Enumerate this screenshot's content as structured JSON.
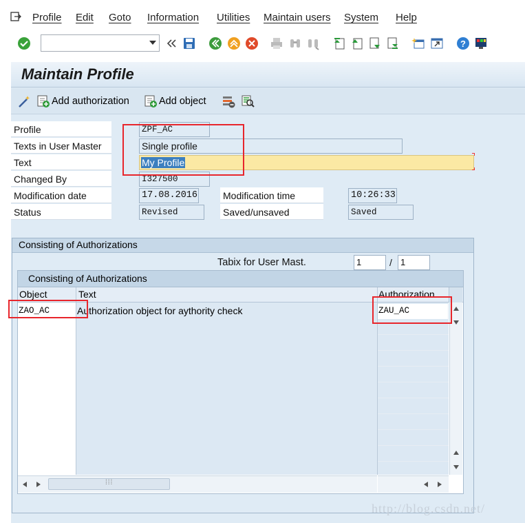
{
  "menu": [
    "Profile",
    "Edit",
    "Goto",
    "Information",
    "Utilities",
    "Maintain users",
    "System",
    "Help"
  ],
  "toolbar": {
    "command_field": "",
    "icons": [
      "enter-icon",
      "back-chevrons-icon",
      "save-icon",
      "back-icon",
      "exit-icon",
      "cancel-icon",
      "print-icon",
      "find-icon",
      "find-next-icon",
      "first-page-icon",
      "prev-page-icon",
      "next-page-icon",
      "last-page-icon",
      "create-session-icon",
      "shortcut-icon",
      "help-icon",
      "layout-icon"
    ]
  },
  "title": "Maintain Profile",
  "app_toolbar": {
    "add_authorization": "Add authorization",
    "add_object": "Add object"
  },
  "form": {
    "profile_label": "Profile",
    "profile_value": "ZPF_AC",
    "texts_label": "Texts in User Master",
    "texts_value": "Single profile",
    "text_label": "Text",
    "text_value": "My Profile",
    "changed_by_label": "Changed By",
    "changed_by_value": "I327500",
    "mod_date_label": "Modification date",
    "mod_date_value": "17.08.2016",
    "mod_time_label": "Modification time",
    "mod_time_value": "10:26:33",
    "status_label": "Status",
    "status_value": "Revised",
    "saved_label": "Saved/unsaved",
    "saved_value": "Saved"
  },
  "group": {
    "title": "Consisting of Authorizations",
    "tabix_label": "Tabix for User Mast.",
    "tabix_value": "1",
    "tabix_sep": "/",
    "tabix_total": "1"
  },
  "table": {
    "title": "Consisting of Authorizations",
    "columns": [
      "Object",
      "Text",
      "Authorization"
    ],
    "rows": [
      {
        "object": "ZAO_AC",
        "text": "Authorization object for aythority check",
        "authorization": "ZAU_AC"
      }
    ]
  },
  "watermark": "http://blog.csdn.net/"
}
